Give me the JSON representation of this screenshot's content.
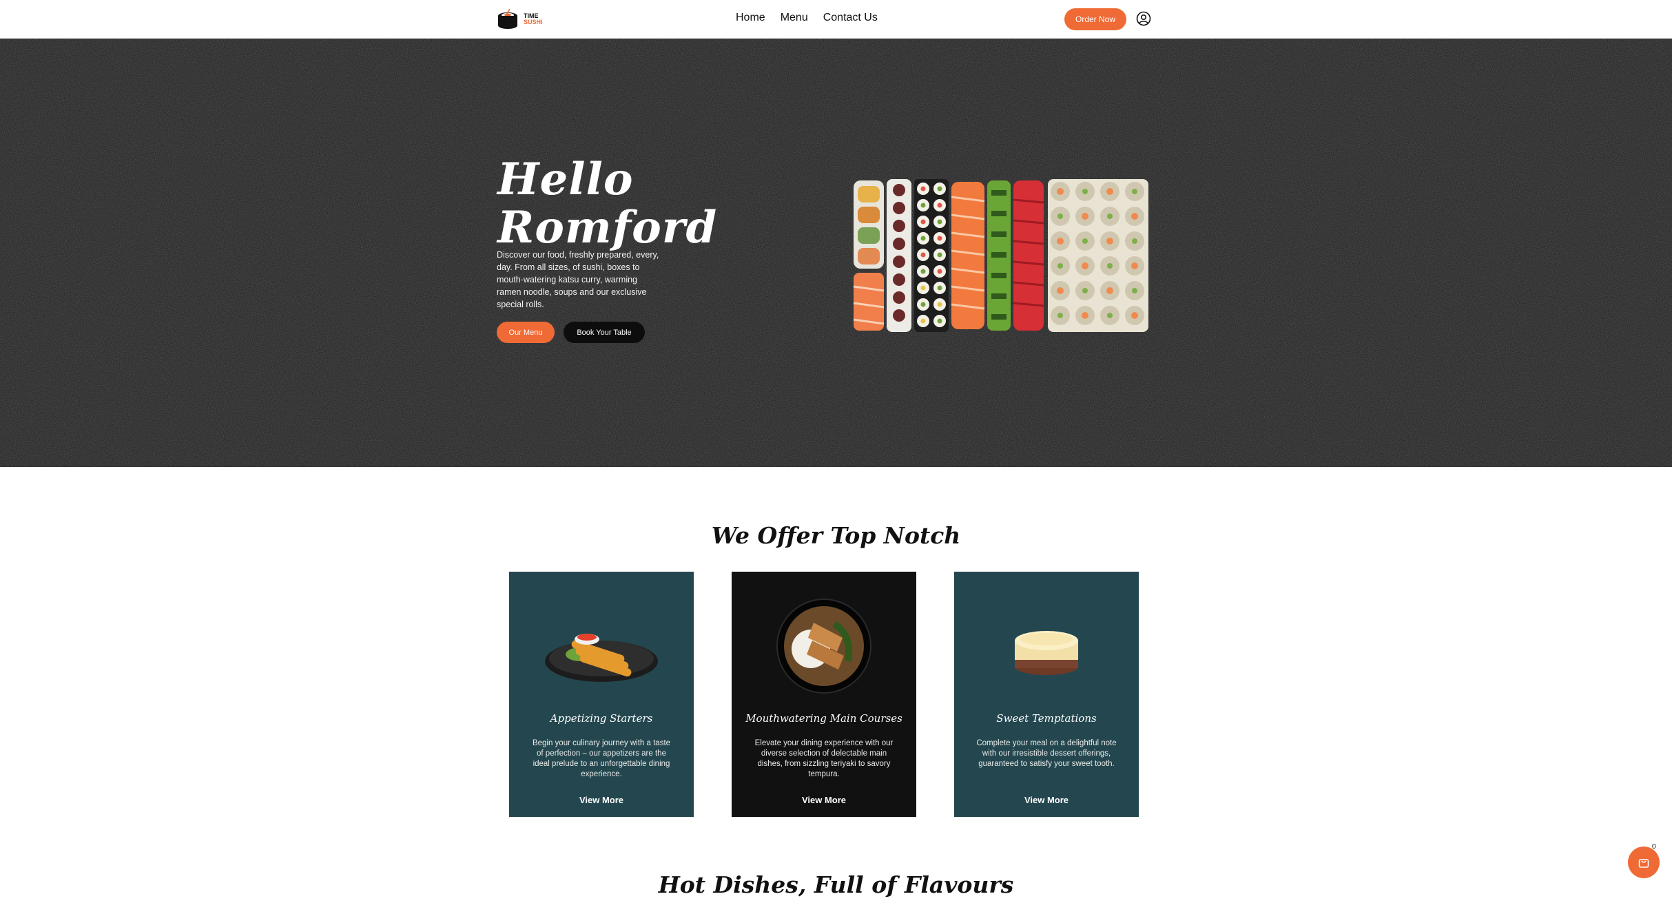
{
  "header": {
    "logo": {
      "line1": "TIME",
      "line2": "SUSHI"
    },
    "nav": [
      {
        "label": "Home"
      },
      {
        "label": "Menu"
      },
      {
        "label": "Contact Us"
      }
    ],
    "order_button": "Order Now",
    "user_icon": "user-circle-icon"
  },
  "hero": {
    "title_line1": "Hello",
    "title_line2": "Romford",
    "description": "Discover our food, freshly prepared, every, day. From all sizes, of sushi, boxes to mouth-watering katsu curry, warming ramen noodle, soups and our exclusive special rolls.",
    "primary_button": "Our Menu",
    "secondary_button": "Book Your Table"
  },
  "offer": {
    "title": "We Offer Top Notch",
    "cards": [
      {
        "title": "Appetizing Starters",
        "description": "Begin your culinary journey with a taste of perfection – our appetizers are the ideal prelude to an unforgettable dining experience.",
        "link": "View More"
      },
      {
        "title": "Mouthwatering Main Courses",
        "description": "Elevate your dining experience with our diverse selection of delectable main dishes, from sizzling teriyaki to savory tempura.",
        "link": "View More"
      },
      {
        "title": "Sweet Temptations",
        "description": "Complete your meal on a delightful note with our irresistible dessert offerings, guaranteed to satisfy your sweet tooth.",
        "link": "View More"
      }
    ]
  },
  "hot_dishes": {
    "title": "Hot Dishes, Full of Flavours"
  },
  "cart": {
    "count": "0",
    "icon": "shopping-bag-icon"
  },
  "colors": {
    "accent": "#f06a35",
    "teal": "#24474f",
    "dark": "#111111",
    "hero_bg": "#1c1c1c"
  }
}
